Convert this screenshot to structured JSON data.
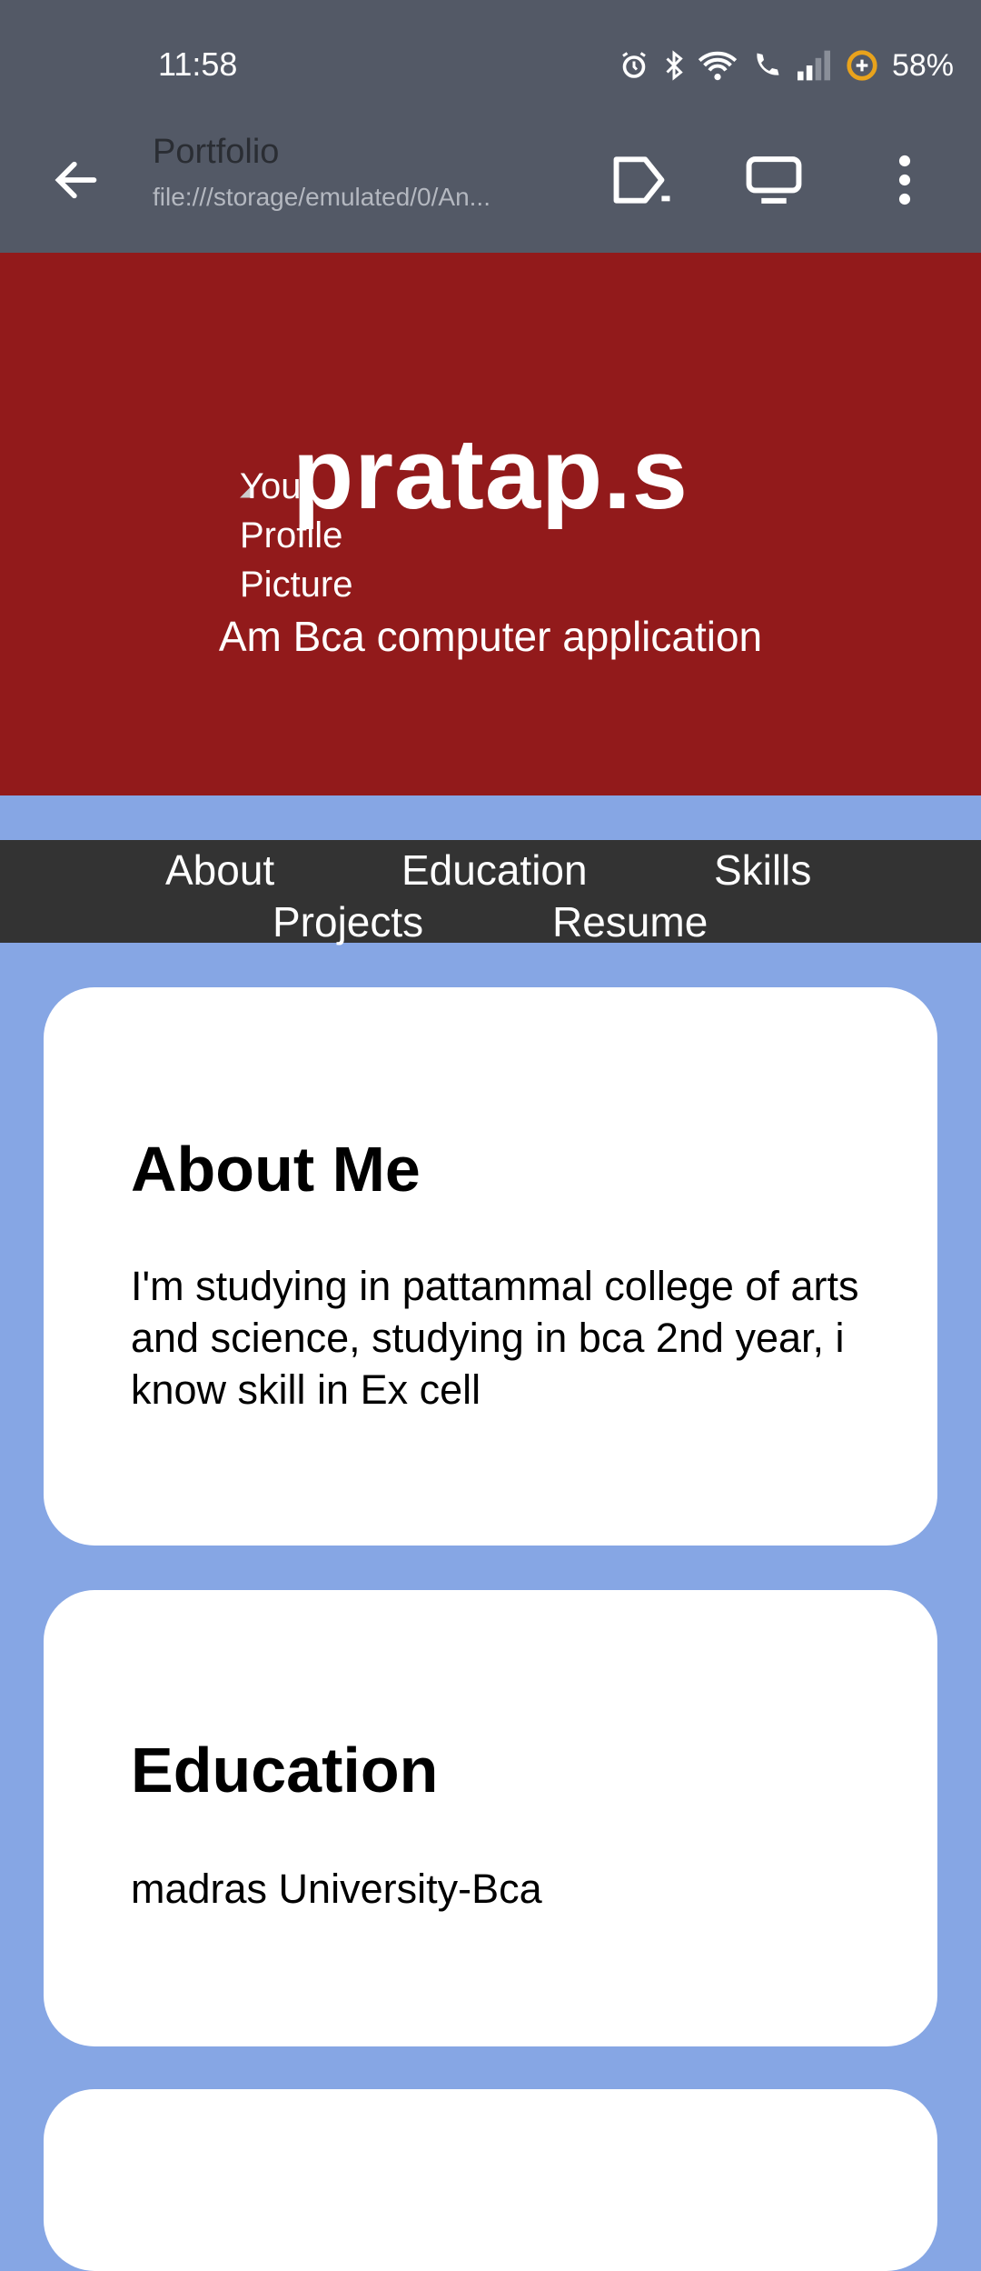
{
  "status": {
    "time": "11:58",
    "battery": "58%"
  },
  "browser": {
    "title": "Portfolio",
    "url": "file:///storage/emulated/0/An...",
    "icons": [
      "back-arrow-icon",
      "edit-icon",
      "desktop-icon",
      "more-vert-icon"
    ]
  },
  "header": {
    "profile_alt": "Your Profile Picture",
    "name": "pratap.s",
    "tagline": "Am Bca computer application"
  },
  "nav": {
    "items": [
      "About",
      "Education",
      "Skills",
      "Projects",
      "Resume"
    ]
  },
  "about": {
    "heading": "About Me",
    "text": "I'm studying in pattammal college of arts and science, studying in bca 2nd year, i know skill in Ex cell"
  },
  "education": {
    "heading": "Education",
    "text": "madras University-Bca"
  },
  "colors": {
    "toolbar": "#535966",
    "header": "#921a1b",
    "nav": "#333333",
    "page": "#86a6e4",
    "card": "#ffffff"
  }
}
